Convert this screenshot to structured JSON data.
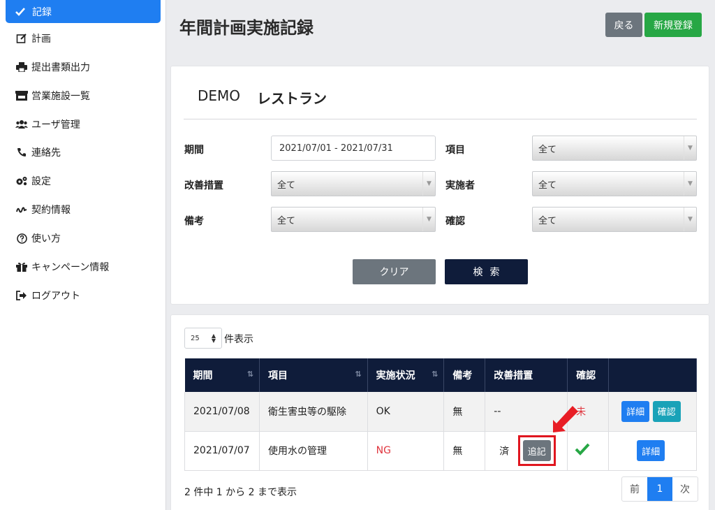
{
  "sidebar": {
    "active": {
      "label": "記録",
      "icon": "check-icon"
    },
    "items": [
      {
        "label": "計画",
        "icon": "edit-icon"
      },
      {
        "label": "提出書類出力",
        "icon": "print-icon"
      },
      {
        "label": "営業施設一覧",
        "icon": "store-icon"
      },
      {
        "label": "ユーザ管理",
        "icon": "users-icon"
      },
      {
        "label": "連絡先",
        "icon": "phone-icon"
      },
      {
        "label": "設定",
        "icon": "gears-icon"
      },
      {
        "label": "契約情報",
        "icon": "signature-icon"
      },
      {
        "label": "使い方",
        "icon": "question-circle-icon"
      },
      {
        "label": "キャンペーン情報",
        "icon": "gift-icon"
      },
      {
        "label": "ログアウト",
        "icon": "sign-out-icon"
      }
    ]
  },
  "header": {
    "title": "年間計画実施記録",
    "back_label": "戻る",
    "new_label": "新規登録"
  },
  "filter": {
    "store_prefix": "DEMO",
    "store_name": "レストラン",
    "period_label": "期間",
    "period_value": "2021/07/01 - 2021/07/31",
    "item_label": "項目",
    "item_value": "全て",
    "improvement_label": "改善措置",
    "improvement_value": "全て",
    "implementer_label": "実施者",
    "implementer_value": "全て",
    "remarks_label": "備考",
    "remarks_value": "全て",
    "confirm_label": "確認",
    "confirm_value": "全て",
    "clear_label": "クリア",
    "search_label": "検索"
  },
  "list": {
    "per_page_value": "25",
    "per_page_suffix": "件表示",
    "columns": [
      "期間",
      "項目",
      "実施状況",
      "備考",
      "改善措置",
      "確認",
      ""
    ],
    "rows": [
      {
        "period": "2021/07/08",
        "item": "衛生害虫等の駆除",
        "status": "OK",
        "remarks": "無",
        "improvement": "--",
        "confirm": "未",
        "detail_label": "詳細",
        "confirm_btn_label": "確認"
      },
      {
        "period": "2021/07/07",
        "item": "使用水の管理",
        "status": "NG",
        "remarks": "無",
        "improvement": "済",
        "append_label": "追記",
        "confirm": "check-mark",
        "detail_label": "詳細"
      }
    ],
    "info": "2 件中 1 から 2 まで表示",
    "pager": {
      "prev": "前",
      "current": "1",
      "next": "次"
    }
  },
  "colors": {
    "primary": "#1f7ef1",
    "navy": "#0f1c3a",
    "success": "#27a745",
    "secondary": "#6c757d",
    "info": "#19a2b8",
    "danger": "#e0353e",
    "highlight": "#e0161f"
  }
}
